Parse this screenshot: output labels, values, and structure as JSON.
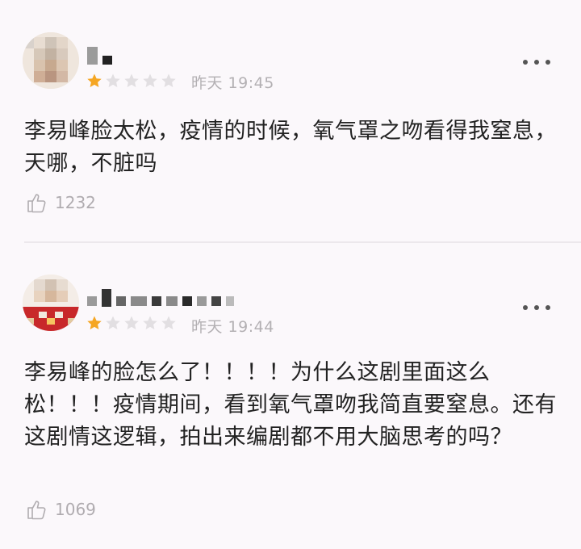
{
  "comments": [
    {
      "username": "",
      "rating": 1,
      "max_rating": 5,
      "time": "昨天 19:45",
      "content": "李易峰脸太松，疫情的时候，氧气罩之吻看得我窒息，天哪，不脏吗",
      "likes": "1232"
    },
    {
      "username": "",
      "rating": 1,
      "max_rating": 5,
      "time": "昨天 19:44",
      "content": "李易峰的脸怎么了！！！！为什么这剧里面这么松！！！疫情期间，看到氧气罩吻我简直要窒息。还有这剧情这逻辑，拍出来编剧都不用大脑思考的吗？",
      "likes": "1069"
    }
  ],
  "icons": {
    "star_filled": "star-filled-icon",
    "star_empty": "star-empty-icon",
    "more": "more-dots-icon",
    "like": "thumbs-up-icon"
  },
  "colors": {
    "star_filled": "#f5a623",
    "star_empty": "#e2dfe2",
    "text": "#222222",
    "meta": "#b3b0b3",
    "background": "#fbf8fb"
  }
}
